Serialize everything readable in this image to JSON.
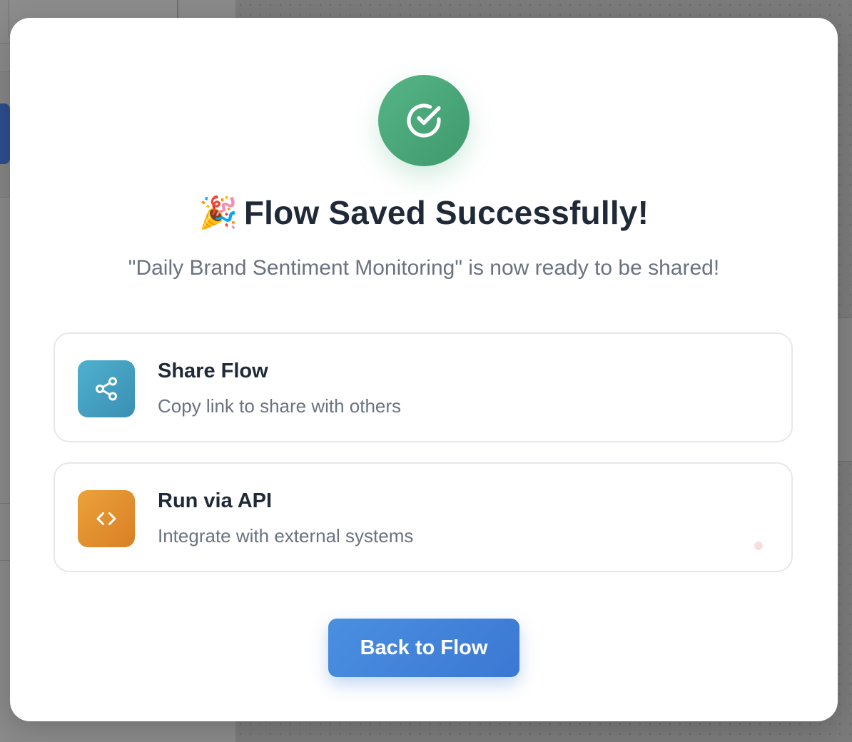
{
  "modal": {
    "emoji": "🎉",
    "title": "Flow Saved Successfully!",
    "subtitle": "\"Daily Brand Sentiment Monitoring\" is now ready to be shared!",
    "success_icon": "check-circle-icon",
    "options": [
      {
        "title": "Share Flow",
        "description": "Copy link to share with others",
        "icon": "share-icon",
        "color": "#4fb0cf"
      },
      {
        "title": "Run via API",
        "description": "Integrate with external systems",
        "icon": "code-icon",
        "color": "#eba23a"
      }
    ],
    "back_button_label": "Back to Flow"
  },
  "colors": {
    "success": "#4ba97a",
    "primary": "#3f80d8",
    "title_text": "#1f2937",
    "muted_text": "#6b7280"
  }
}
